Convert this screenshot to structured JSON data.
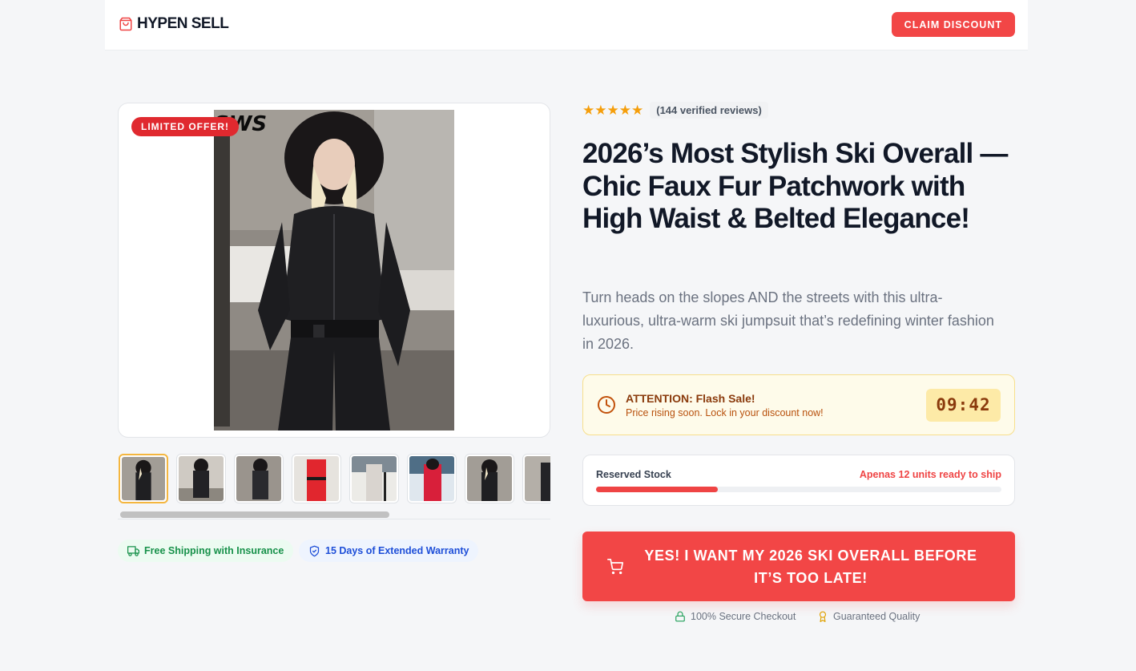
{
  "header": {
    "brand": "HYPEN SELL",
    "claim_button": "CLAIM DISCOUNT"
  },
  "gallery": {
    "badge": "LIMITED OFFER!",
    "photo_watermark": "SWS",
    "thumbnails": [
      {
        "name": "black-overall-front",
        "active": true
      },
      {
        "name": "black-overall-pose"
      },
      {
        "name": "black-overall-side"
      },
      {
        "name": "red-overall"
      },
      {
        "name": "white-overall-snow"
      },
      {
        "name": "red-overall-snow"
      },
      {
        "name": "black-overall-front-2"
      },
      {
        "name": "black-overall-partial"
      }
    ]
  },
  "benefits": {
    "shipping": "Free Shipping with Insurance",
    "warranty": "15 Days of Extended Warranty"
  },
  "product": {
    "rating": 5,
    "reviews": "(144 verified reviews)",
    "title": "2026’s Most Stylish Ski Overall — Chic Faux Fur Patchwork with High Waist & Belted Elegance!",
    "description": "Turn heads on the slopes AND the streets with this ultra-luxurious, ultra-warm ski jumpsuit that’s redefining winter fashion in 2026."
  },
  "flash_sale": {
    "title": "ATTENTION: Flash Sale!",
    "subtitle": "Price rising soon. Lock in your discount now!",
    "timer": "09:42"
  },
  "stock": {
    "label": "Reserved Stock",
    "status": "Apenas 12 units ready to ship",
    "level_percent": 30
  },
  "cta": {
    "label": "YES! I WANT MY 2026 SKI OVERALL BEFORE IT’S TOO LATE!"
  },
  "trust": {
    "secure": "100% Secure Checkout",
    "quality": "Guaranteed Quality"
  },
  "colors": {
    "accent": "#f24646",
    "flash_bg": "#fefbea",
    "success": "#17914a",
    "info": "#1d4ed8"
  }
}
